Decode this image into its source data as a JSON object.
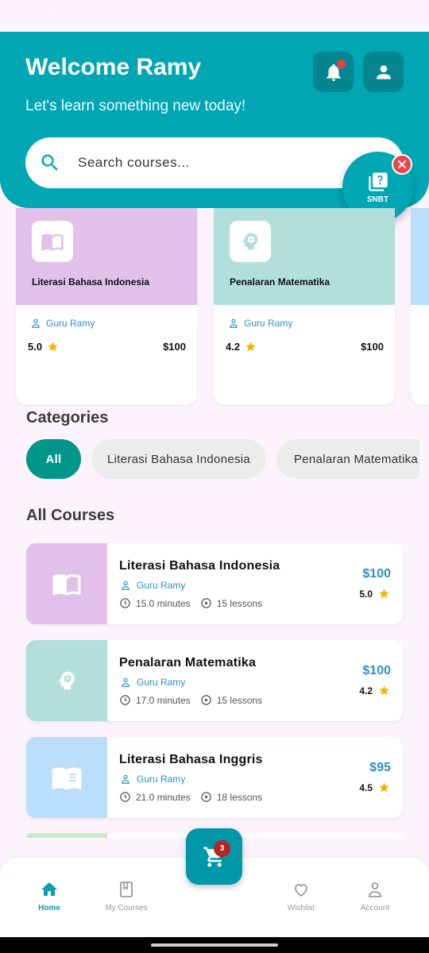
{
  "status_bar": {
    "time": "11:56",
    "icons": "◐ ◎ ▾ ▴ ▮"
  },
  "header": {
    "title": "Welcome Ramy",
    "subtitle": "Let's learn something new today!",
    "search_placeholder": "Search courses...",
    "notification_icon": "bell-icon",
    "profile_icon": "person-icon"
  },
  "snbt": {
    "label": "SNBT",
    "icon": "quiz-book-icon"
  },
  "featured": [
    {
      "title": "Literasi Bahasa Indonesia",
      "instructor": "Guru Ramy",
      "rating": "5.0",
      "price": "$100",
      "color": "#e1c1e9",
      "icon": "book-open-icon"
    },
    {
      "title": "Penalaran Matematika",
      "instructor": "Guru Ramy",
      "rating": "4.2",
      "price": "$100",
      "color": "#b2dfdc",
      "icon": "brain-gear-icon"
    }
  ],
  "categories": {
    "title": "Categories",
    "items": [
      "All",
      "Literasi Bahasa Indonesia",
      "Penalaran Matematika"
    ]
  },
  "all_courses": {
    "title": "All Courses",
    "items": [
      {
        "title": "Literasi Bahasa Indonesia",
        "instructor": "Guru Ramy",
        "duration": "15.0 minutes",
        "lessons": "15 lessons",
        "price": "$100",
        "rating": "5.0",
        "color": "#e1c1e9",
        "icon": "book-open-icon"
      },
      {
        "title": "Penalaran Matematika",
        "instructor": "Guru Ramy",
        "duration": "17.0 minutes",
        "lessons": "15 lessons",
        "price": "$100",
        "rating": "4.2",
        "color": "#b2dfdc",
        "icon": "brain-gear-icon"
      },
      {
        "title": "Literasi Bahasa Inggris",
        "instructor": "Guru Ramy",
        "duration": "21.0 minutes",
        "lessons": "18 lessons",
        "price": "$95",
        "rating": "4.5",
        "color": "#bbdefb",
        "icon": "book-text-icon"
      }
    ]
  },
  "cart": {
    "count": "3"
  },
  "nav": {
    "home": "Home",
    "my_courses": "My Courses",
    "wishlist": "Wishlist",
    "account": "Account"
  },
  "colors": {
    "primary": "#00a6b4",
    "active_chip": "#00968a",
    "price": "#2d8fc6",
    "star": "#f5b301"
  }
}
